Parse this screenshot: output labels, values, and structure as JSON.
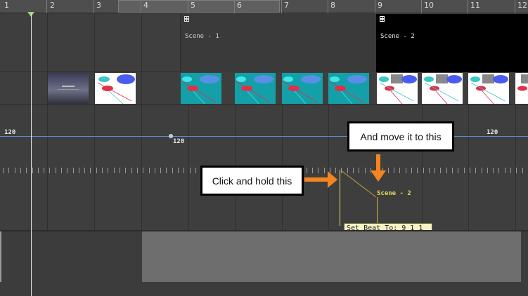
{
  "ruler": {
    "bars": [
      "1",
      "2",
      "3",
      "4",
      "5",
      "6",
      "7",
      "8",
      "9",
      "10",
      "11",
      "12"
    ]
  },
  "scenes": [
    {
      "name": "Scene - 1"
    },
    {
      "name": "Scene - 2"
    }
  ],
  "tempo": {
    "start": "120",
    "point": "120",
    "end": "120"
  },
  "callouts": {
    "click": "Click and hold this",
    "move": "And move it to this"
  },
  "marker": {
    "scene_label": "Scene - 2"
  },
  "tooltip": {
    "text": "Set Beat To: 9 1 1 151"
  },
  "colors": {
    "accent_orange": "#f5851f",
    "tempo_line": "#5a8ccd",
    "marker_yellow": "#e8e04a",
    "playhead_green": "#9cd27a"
  },
  "icons": [
    "clapperboard-icon",
    "playhead-marker-icon",
    "arrow-right-icon",
    "arrow-down-icon"
  ]
}
